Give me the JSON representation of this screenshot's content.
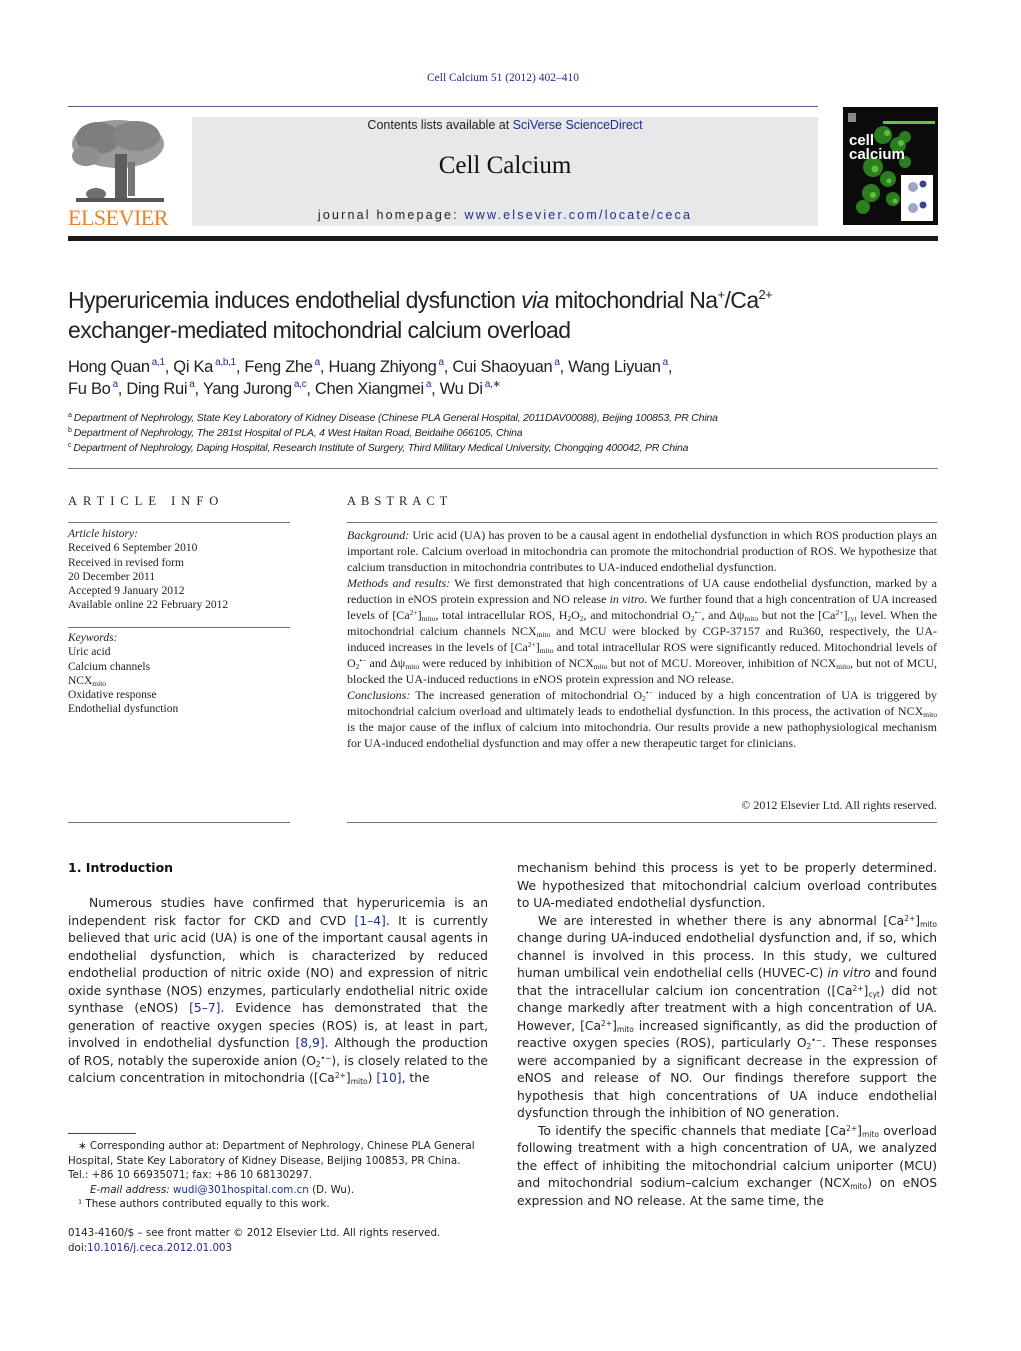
{
  "header": {
    "citation": "Cell Calcium 51 (2012) 402–410",
    "contents_prefix": "Contents lists available at ",
    "contents_link": "SciVerse ScienceDirect",
    "journal_name": "Cell Calcium",
    "homepage_prefix": "journal homepage: ",
    "homepage_link": "www.elsevier.com/locate/ceca",
    "publisher_logo_text": "ELSEVIER",
    "cover_title_line1": "cell",
    "cover_title_line2": "calcium",
    "brand_color": "#e9822a",
    "link_color": "#1f2b8f"
  },
  "article": {
    "title_part1": "Hyperuricemia induces endothelial dysfunction ",
    "title_italic": "via",
    "title_part2": " mitochondrial Na",
    "title_sup1": "+",
    "title_part3": "/Ca",
    "title_sup2": "2+",
    "title_line2": "exchanger-mediated mitochondrial calcium overload",
    "authors": [
      {
        "name": "Hong Quan",
        "aff": "a,1",
        "sep": ", "
      },
      {
        "name": "Qi Ka",
        "aff": "a,b,1",
        "sep": ", "
      },
      {
        "name": "Feng Zhe",
        "aff": "a",
        "sep": ", "
      },
      {
        "name": "Huang Zhiyong",
        "aff": "a",
        "sep": ", "
      },
      {
        "name": "Cui Shaoyuan",
        "aff": "a",
        "sep": ", "
      },
      {
        "name": "Wang Liyuan",
        "aff": "a",
        "sep": ","
      },
      {
        "name": "Fu Bo",
        "aff": "a",
        "sep": ", "
      },
      {
        "name": "Ding Rui",
        "aff": "a",
        "sep": ", "
      },
      {
        "name": "Yang Jurong",
        "aff": "a,c",
        "sep": ", "
      },
      {
        "name": "Chen Xiangmei",
        "aff": "a",
        "sep": ", "
      },
      {
        "name": "Wu Di",
        "aff": "a,∗",
        "sep": ""
      }
    ],
    "affiliations": [
      {
        "key": "a",
        "text": "Department of Nephrology, State Key Laboratory of Kidney Disease (Chinese PLA General Hospital, 2011DAV00088), Beijing 100853, PR China"
      },
      {
        "key": "b",
        "text": "Department of Nephrology, The 281st Hospital of PLA, 4 West Haitan Road, Beidaihe 066105, China"
      },
      {
        "key": "c",
        "text": "Department of Nephrology, Daping Hospital, Research Institute of Surgery, Third Military Medical University, Chongqing 400042, PR China"
      }
    ]
  },
  "article_info": {
    "heading": "ARTICLE INFO",
    "history_label": "Article history:",
    "history": [
      "Received 6 September 2010",
      "Received in revised form",
      "20 December 2011",
      "Accepted 9 January 2012",
      "Available online 22 February 2012"
    ],
    "keywords_label": "Keywords:",
    "keywords": [
      "Uric acid",
      "Calcium channels",
      "NCX",
      "Oxidative response",
      "Endothelial dysfunction"
    ],
    "keyword_ncx_sub": "mito"
  },
  "abstract": {
    "heading": "ABSTRACT",
    "background_label": "Background:",
    "background": "Uric acid (UA) has proven to be a causal agent in endothelial dysfunction in which ROS production plays an important role. Calcium overload in mitochondria can promote the mitochondrial production of ROS. We hypothesize that calcium transduction in mitochondria contributes to UA-induced endothelial dysfunction.",
    "methods_label": "Methods and results:",
    "methods_html": "We first demonstrated that high concentrations of UA cause endothelial dysfunction, marked by a reduction in eNOS protein expression and NO release <i>in vitro</i>. We further found that a high concentration of UA increased levels of [Ca<sup class=\"s\">2+</sup>]<sub class=\"s\">mito</sub>, total intracellular ROS, H<sub class=\"s\">2</sub>O<sub class=\"s\">2</sub>, and mitochondrial O<sub class=\"s\">2</sub><sup class=\"s\">•−</sup>, and Δψ<sub class=\"s\">mito</sub> but not the [Ca<sup class=\"s\">2+</sup>]<sub class=\"s\">cyt</sub> level. When the mitochondrial calcium channels NCX<sub class=\"s\">mito</sub> and MCU were blocked by CGP-37157 and Ru360, respectively, the UA-induced increases in the levels of [Ca<sup class=\"s\">2+</sup>]<sub class=\"s\">mito</sub> and total intracellular ROS were significantly reduced. Mitochondrial levels of O<sub class=\"s\">2</sub><sup class=\"s\">•−</sup> and Δψ<sub class=\"s\">mito</sub> were reduced by inhibition of NCX<sub class=\"s\">mito</sub> but not of MCU. Moreover, inhibition of NCX<sub class=\"s\">mito</sub>, but not of MCU, blocked the UA-induced reductions in eNOS protein expression and NO release.",
    "conclusions_label": "Conclusions:",
    "conclusions_html": "The increased generation of mitochondrial O<sub class=\"s\">2</sub><sup class=\"s\">•−</sup> induced by a high concentration of UA is triggered by mitochondrial calcium overload and ultimately leads to endothelial dysfunction. In this process, the activation of NCX<sub class=\"s\">mito</sub> is the major cause of the influx of calcium into mitochondria. Our results provide a new pathophysiological mechanism for UA-induced endothelial dysfunction and may offer a new therapeutic target for clinicians.",
    "copyright": "© 2012 Elsevier Ltd. All rights reserved."
  },
  "body": {
    "section_heading": "1.  Introduction",
    "left_html": "Numerous studies have confirmed that hyperuricemia is an independent risk factor for CKD and CVD <span class=\"ref\">[1–4]</span>. It is currently believed that uric acid (UA) is one of the important causal agents in endothelial dysfunction, which is characterized by reduced endothelial production of nitric oxide (NO) and expression of nitric oxide synthase (NOS) enzymes, particularly endothelial nitric oxide synthase (eNOS) <span class=\"ref\">[5–7]</span>. Evidence has demonstrated that the generation of reactive oxygen species (ROS) is, at least in part, involved in endothelial dysfunction <span class=\"ref\">[8,9]</span>. Although the production of ROS, notably the superoxide anion (O<sub class=\"s\">2</sub><sup class=\"s\">•−</sup>), is closely related to the calcium concentration in mitochondria ([Ca<sup class=\"s\">2+</sup>]<sub class=\"s\">mito</sub>) <span class=\"ref\">[10]</span>, the",
    "right_p1_html": "mechanism behind this process is yet to be properly determined. We hypothesized that mitochondrial calcium overload contributes to UA-mediated endothelial dysfunction.",
    "right_p2_html": "We are interested in whether there is any abnormal [Ca<sup class=\"s\">2+</sup>]<sub class=\"s\">mito</sub> change during UA-induced endothelial dysfunction and, if so, which channel is involved in this process. In this study, we cultured human umbilical vein endothelial cells (HUVEC-C) <i>in vitro</i> and found that the intracellular calcium ion concentration ([Ca<sup class=\"s\">2+</sup>]<sub class=\"s\">cyt</sub>) did not change markedly after treatment with a high concentration of UA. However, [Ca<sup class=\"s\">2+</sup>]<sub class=\"s\">mito</sub> increased significantly, as did the production of reactive oxygen species (ROS), particularly O<sub class=\"s\">2</sub><sup class=\"s\">•−</sup>. These responses were accompanied by a significant decrease in the expression of eNOS and release of NO. Our findings therefore support the hypothesis that high concentrations of UA induce endothelial dysfunction through the inhibition of NO generation.",
    "right_p3_html": "To identify the specific channels that mediate [Ca<sup class=\"s\">2+</sup>]<sub class=\"s\">mito</sub> overload following treatment with a high concentration of UA, we analyzed the effect of inhibiting the mitochondrial calcium uniporter (MCU) and mitochondrial sodium–calcium exchanger (NCX<sub class=\"s\">mito</sub>) on eNOS expression and NO release. At the same time, the"
  },
  "footnotes": {
    "corresponding": "∗  Corresponding author at: Department of Nephrology, Chinese PLA General Hospital, State Key Laboratory of Kidney Disease, Beijing 100853, PR China.",
    "tel": "Tel.: +86 10 66935071; fax: +86 10 68130297.",
    "email_label": "E-mail address: ",
    "email": "wudi@301hospital.com.cn",
    "email_suffix": " (D. Wu).",
    "equal_contrib": "¹  These authors contributed equally to this work.",
    "front_matter": "0143-4160/$ – see front matter © 2012 Elsevier Ltd. All rights reserved.",
    "doi_prefix": "doi:",
    "doi": "10.1016/j.ceca.2012.01.003"
  }
}
